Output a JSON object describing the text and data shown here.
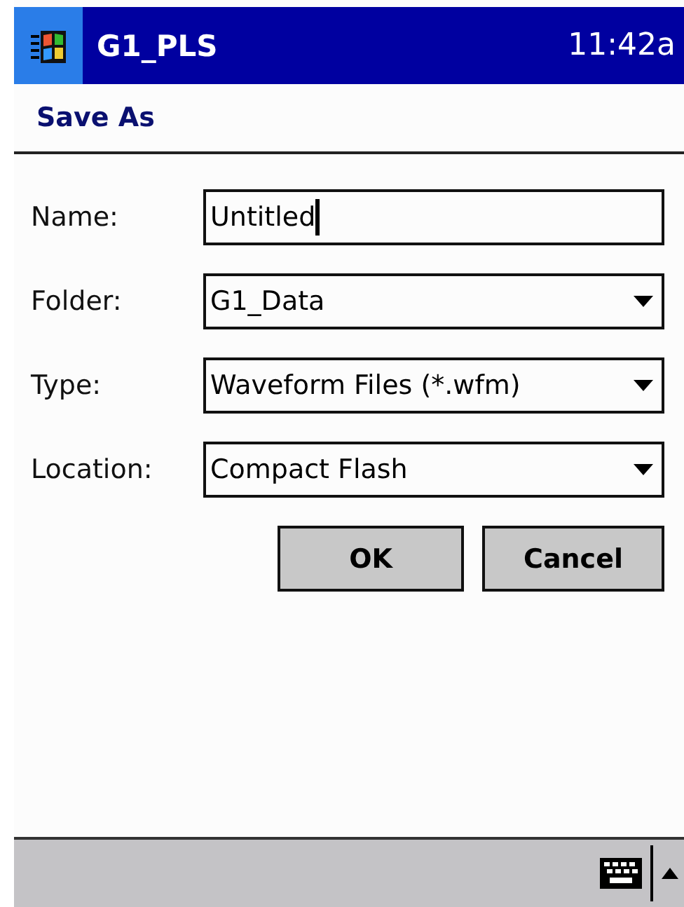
{
  "title_bar": {
    "title": "G1_PLS",
    "time": "11:42a"
  },
  "dialog": {
    "title": "Save As"
  },
  "fields": [
    {
      "label": "Name:",
      "kind": "text",
      "value": "Untitled",
      "focused": true
    },
    {
      "label": "Folder:",
      "kind": "dropdown",
      "value": "G1_Data"
    },
    {
      "label": "Type:",
      "kind": "dropdown",
      "value": "Waveform Files (*.wfm)"
    },
    {
      "label": "Location:",
      "kind": "dropdown",
      "value": "Compact Flash"
    }
  ],
  "buttons": [
    "OK",
    "Cancel"
  ]
}
